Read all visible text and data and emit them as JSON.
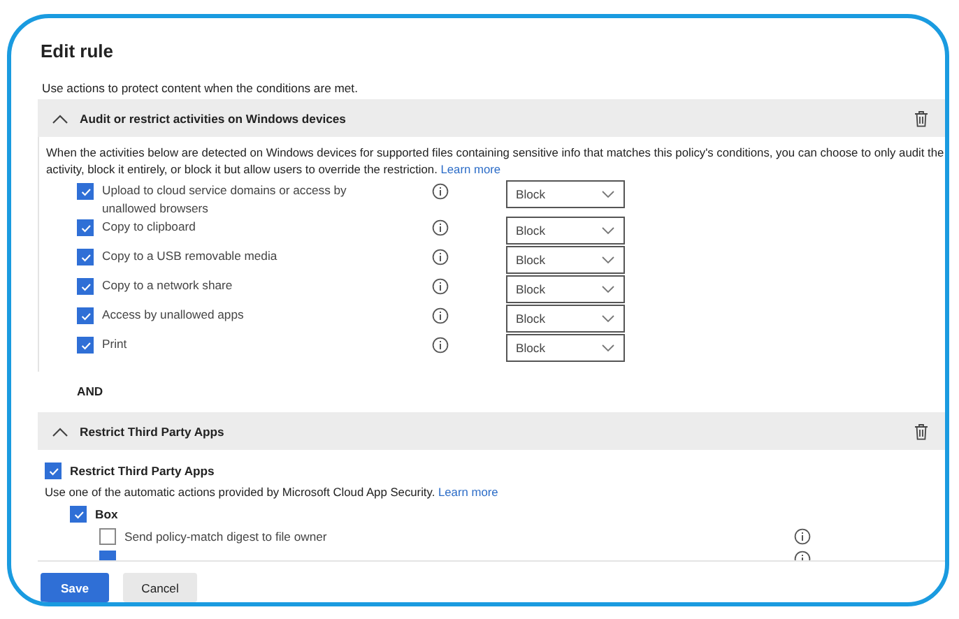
{
  "title": "Edit rule",
  "intro": "Use actions to protect content when the conditions are met.",
  "sections": [
    {
      "kind": "activities",
      "title": "Audit or restrict activities on Windows devices",
      "expanded": true,
      "description": "When the activities below are detected on Windows devices for supported files containing sensitive info that matches this policy's conditions, you can choose to only audit the activity, block it entirely, or block it but allow users to override the restriction.",
      "link": "Learn more",
      "activities": [
        {
          "label": "Upload to cloud service domains or access by unallowed browsers",
          "checked": true,
          "action": "Block"
        },
        {
          "label": "Copy to clipboard",
          "checked": true,
          "action": "Block"
        },
        {
          "label": "Copy to a USB removable media",
          "checked": true,
          "action": "Block"
        },
        {
          "label": "Copy to a network share",
          "checked": true,
          "action": "Block"
        },
        {
          "label": "Access by unallowed apps",
          "checked": true,
          "action": "Block"
        },
        {
          "label": "Print",
          "checked": true,
          "action": "Block"
        }
      ]
    },
    {
      "kind": "separator",
      "label": "AND"
    },
    {
      "kind": "apps",
      "title": "Restrict Third Party Apps",
      "expanded": true,
      "option": {
        "label": "Restrict Third Party Apps",
        "checked": true
      },
      "description": "Use one of the automatic actions provided by Microsoft Cloud App Security.",
      "link": "Learn more",
      "app": {
        "label": "Box",
        "checked": true
      },
      "actions": [
        {
          "label": "Send policy-match digest to file owner",
          "checked": false
        },
        {
          "checked": true
        }
      ]
    }
  ],
  "buttons": [
    {
      "label": "Save",
      "kind": "primary"
    },
    {
      "label": "Cancel",
      "kind": "secondary"
    }
  ]
}
